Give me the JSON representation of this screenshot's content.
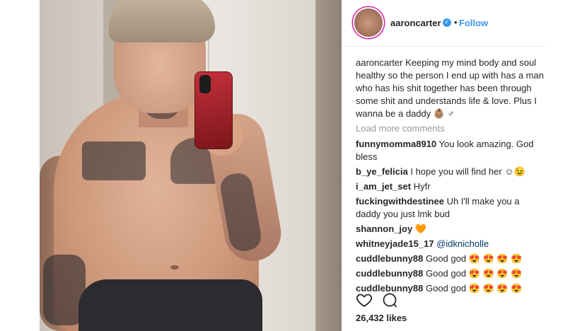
{
  "post": {
    "username": "aaroncarter",
    "verified_icon": "verified-badge-icon",
    "separator": "•",
    "follow_label": "Follow"
  },
  "caption": {
    "username": "aaroncarter",
    "text": "Keeping my mind body and soul healthy so the person I end up with has a man who has his shit together has been through some shit and understands life & love. Plus I wanna be a daddy 👶🏽 ♂"
  },
  "load_more": "Load more comments",
  "comments": [
    {
      "user": "funnymomma8910",
      "text": "You look amazing. God bless"
    },
    {
      "user": "b_ye_felicia",
      "text": "I hope you will find her ☺😉"
    },
    {
      "user": "i_am_jet_set",
      "text": "Hyfr"
    },
    {
      "user": "fuckingwithdestinee",
      "text": "Uh I'll make you a daddy you just lmk bud"
    },
    {
      "user": "shannon_joy",
      "text": "🧡"
    },
    {
      "user": "whitneyjade15_17",
      "text": "@idknicholle"
    },
    {
      "user": "cuddlebunny88",
      "text": "Good god 😍 😍 😍 😍"
    },
    {
      "user": "cuddlebunny88",
      "text": "Good god 😍 😍 😍 😍"
    },
    {
      "user": "cuddlebunny88",
      "text": "Good god 😍 😍 😍 😍"
    }
  ],
  "actions": {
    "like_icon": "heart-icon",
    "comment_icon": "comment-icon"
  },
  "likes": "26,432 likes",
  "colors": {
    "link_blue": "#3897f0",
    "text": "#262626",
    "muted": "#999999",
    "mention": "#003569"
  }
}
